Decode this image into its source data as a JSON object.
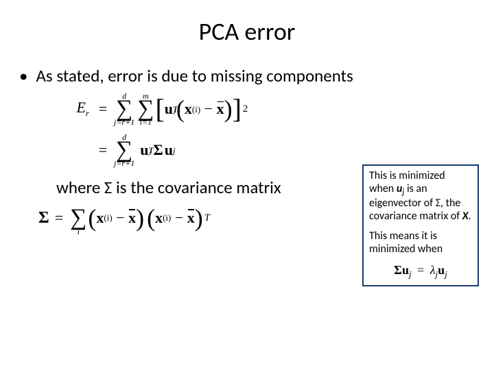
{
  "title": "PCA error",
  "bullet_dot": "•",
  "bullet_text": "As stated, error is due to missing components",
  "eq1": {
    "lhs": "E",
    "lhs_sub": "r",
    "eq": "=",
    "sum1_top": "d",
    "sum1_bot": "j=r+1",
    "sum2_top": "m",
    "sum2_bot": "i=1",
    "u": "u",
    "u_sub": "j",
    "u_sup": "T",
    "x": "x",
    "x_sup": "(i)",
    "minus": "−",
    "xbar": "x",
    "outer_sup": "2"
  },
  "eq2": {
    "eq": "=",
    "sum_top": "d",
    "sum_bot": "j=r+1",
    "u": "u",
    "u_sub": "j",
    "u_sup": "T",
    "Sigma": "Σ",
    "u2": "u",
    "u2_sub": "j"
  },
  "where_line": "where Σ is the covariance matrix",
  "cov": {
    "Sigma": "Σ",
    "eq": "=",
    "sum_bot": "i",
    "x": "x",
    "x_sup": "(i)",
    "minus": "−",
    "xbar": "x",
    "outer_sup": "T"
  },
  "callout": {
    "p1_a": "This is minimized when ",
    "p1_uj": "u",
    "p1_uj_sub": "j",
    "p1_b": " is an eigenvector of Σ, the covariance matrix of ",
    "p1_X": "X",
    "p1_c": ".",
    "p2": "This means it is minimized when",
    "eq_Sigma": "Σ",
    "eq_u": "u",
    "eq_u_sub": "j",
    "eq_eq": "=",
    "eq_lam": "λ",
    "eq_lam_sub": "j",
    "eq_u2": "u",
    "eq_u2_sub": "j"
  }
}
